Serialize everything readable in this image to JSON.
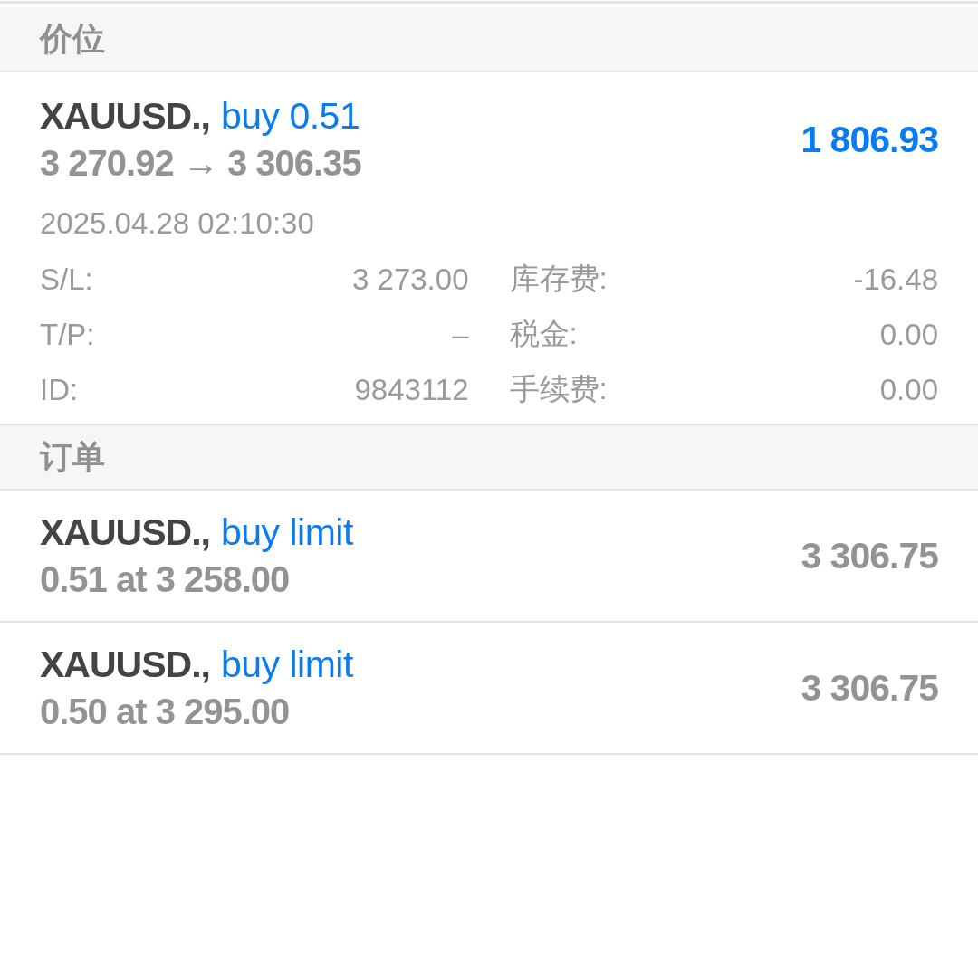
{
  "positions": {
    "title": "价位",
    "items": [
      {
        "symbol": "XAUUSD.,",
        "type": "buy 0.51",
        "prices": "3 270.92 → 3 306.35",
        "profit": "1 806.93",
        "time": "2025.04.28 02:10:30",
        "details": [
          {
            "label": "S/L:",
            "value": "3 273.00"
          },
          {
            "label": "库存费:",
            "value": "-16.48"
          },
          {
            "label": "T/P:",
            "value": "–"
          },
          {
            "label": "税金:",
            "value": "0.00"
          },
          {
            "label": "ID:",
            "value": "9843112"
          },
          {
            "label": "手续费:",
            "value": "0.00"
          }
        ]
      }
    ]
  },
  "orders": {
    "title": "订单",
    "items": [
      {
        "symbol": "XAUUSD.,",
        "type": "buy limit",
        "volume_price": "0.51 at 3 258.00",
        "current": "3 306.75"
      },
      {
        "symbol": "XAUUSD.,",
        "type": "buy limit",
        "volume_price": "0.50 at 3 295.00",
        "current": "3 306.75"
      }
    ]
  }
}
